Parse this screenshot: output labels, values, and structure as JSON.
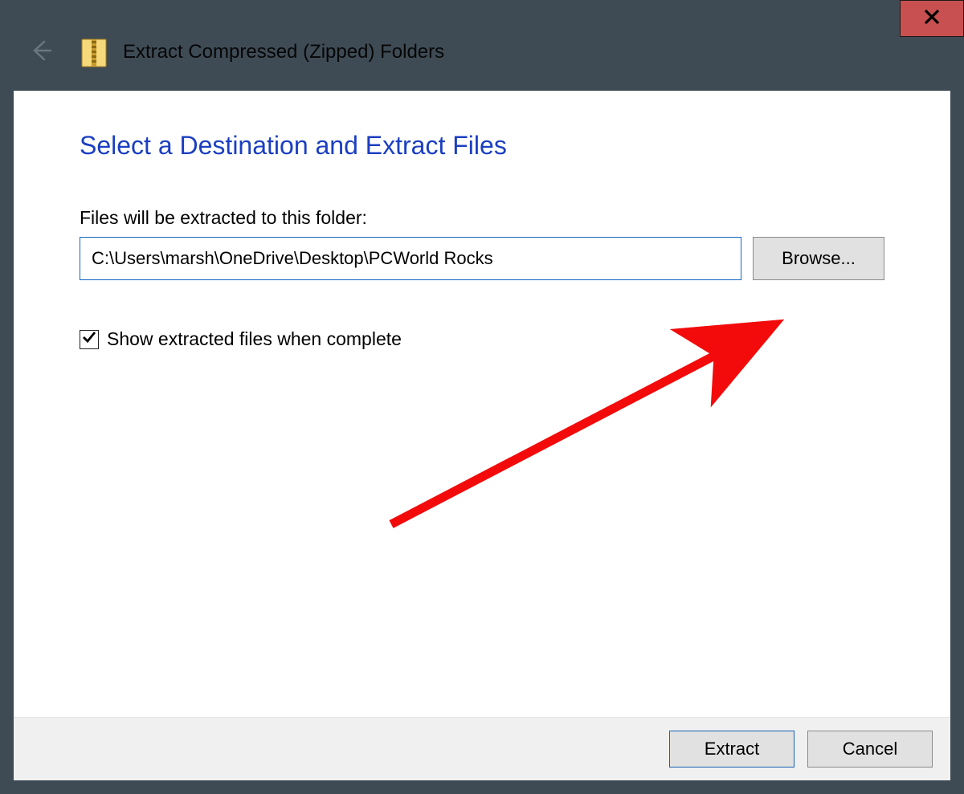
{
  "titlebar": {
    "title": "Extract Compressed (Zipped) Folders"
  },
  "content": {
    "heading": "Select a Destination and Extract Files",
    "path_label": "Files will be extracted to this folder:",
    "path_value": "C:\\Users\\marsh\\OneDrive\\Desktop\\PCWorld Rocks",
    "browse_label": "Browse...",
    "checkbox_label": "Show extracted files when complete",
    "checkbox_checked": true
  },
  "footer": {
    "extract_label": "Extract",
    "cancel_label": "Cancel"
  }
}
